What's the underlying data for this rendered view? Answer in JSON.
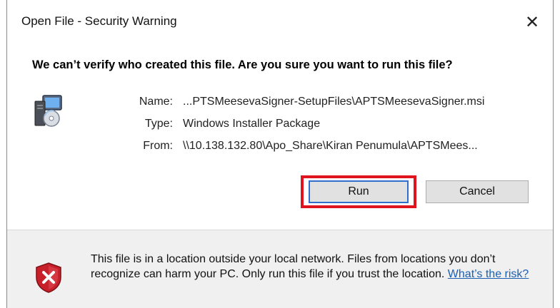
{
  "window": {
    "title": "Open File - Security Warning",
    "close_icon": "close-icon"
  },
  "question": "We can’t verify who created this file. Are you sure you want to run this file?",
  "fields": [
    {
      "label": "Name:",
      "value": "...PTSMeesevaSigner-SetupFiles\\APTSMeesevaSigner.msi"
    },
    {
      "label": "Type:",
      "value": "Windows Installer Package"
    },
    {
      "label": "From:",
      "value": "\\\\10.138.132.80\\Apo_Share\\Kiran Penumula\\APTSMees..."
    }
  ],
  "buttons": {
    "run": "Run",
    "cancel": "Cancel"
  },
  "warning": {
    "text": "This file is in a location outside your local network. Files from locations you don’t recognize can harm your PC. Only run this file if you trust the location.",
    "link": "What’s the risk?"
  },
  "colors": {
    "highlight": "#e0141e",
    "link": "#1a5fb4",
    "shield": "#c8202a"
  }
}
